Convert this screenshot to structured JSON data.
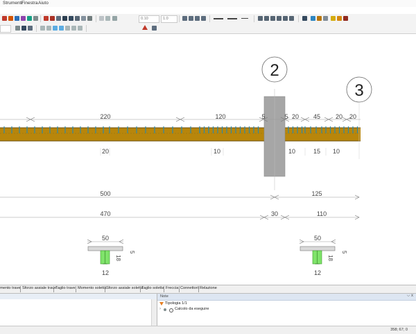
{
  "menu": {
    "items": [
      "Strumenti",
      "Finestra",
      "Aiuto"
    ]
  },
  "toolbar": {
    "field_1": "0.10",
    "field_2": "1.0"
  },
  "tabs": [
    "mento trave",
    "Sforzo assiale trave",
    "Taglio trave",
    "Momento soletta",
    "Sforzo assiale soletta",
    "Taglio soletta",
    "Freccia",
    "Connettori",
    "Relazione"
  ],
  "notes": {
    "title": "Note",
    "pin": "⌵ x",
    "header": "Tipologia 1/1",
    "item": "Calcolo da eseguire"
  },
  "status": {
    "coords": "358; 67; 0"
  },
  "drawing": {
    "support_2": "2",
    "support_3": "3",
    "top_dims": [
      "220",
      "120",
      "5",
      "5",
      "20",
      "45",
      "20",
      "20"
    ],
    "under_dims": [
      "20",
      "10",
      "10",
      "15",
      "10"
    ],
    "span_dims": [
      "500",
      "125"
    ],
    "span_dims_2": [
      "470",
      "30",
      "110"
    ],
    "section_left": {
      "width": "50",
      "thickness": "5",
      "height": "18",
      "base": "12"
    },
    "section_right": {
      "width": "50",
      "thickness": "5",
      "height": "18",
      "base": "12"
    }
  },
  "colors": {
    "beam": "#b8860b",
    "beam_dark": "#6b4f0f",
    "connector": "#2e8aa8",
    "column": "#a6a6a6",
    "section_web": "#7fe36a"
  }
}
